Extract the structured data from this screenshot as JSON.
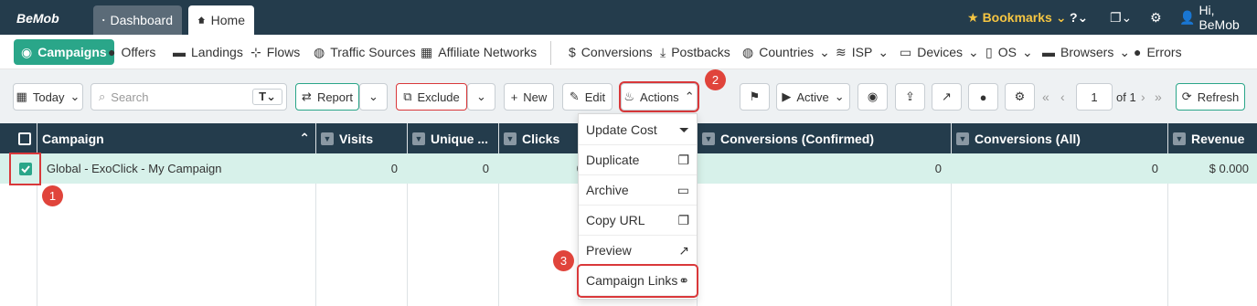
{
  "topbar": {
    "logo": "BeMob",
    "dashboard": "Dashboard",
    "home": "Home",
    "bookmarks": "Bookmarks",
    "user": "Hi, BeMob"
  },
  "nav": {
    "campaigns": "Campaigns",
    "offers": "Offers",
    "landings": "Landings",
    "flows": "Flows",
    "traffic": "Traffic Sources",
    "affiliate": "Affiliate Networks",
    "conversions": "Conversions",
    "postbacks": "Postbacks",
    "countries": "Countries",
    "isp": "ISP",
    "devices": "Devices",
    "os": "OS",
    "browsers": "Browsers",
    "errors": "Errors"
  },
  "toolbar": {
    "date": "Today",
    "search_placeholder": "Search",
    "report": "Report",
    "exclude": "Exclude",
    "new": "New",
    "edit": "Edit",
    "actions": "Actions",
    "active": "Active",
    "page": "1",
    "of": "of 1",
    "refresh": "Refresh"
  },
  "table": {
    "headers": [
      "Campaign",
      "Visits",
      "Unique ...",
      "Clicks",
      "Conversions (Confirmed)",
      "Conversions (All)",
      "Revenue"
    ],
    "row": {
      "name": "Global - ExoClick - My Campaign",
      "visits": "0",
      "unique": "0",
      "clicks": "0",
      "conv_confirmed": "0",
      "conv_all": "0",
      "revenue": "$ 0.000"
    }
  },
  "menu": [
    "Update Cost",
    "Duplicate",
    "Archive",
    "Copy URL",
    "Preview",
    "Campaign Links"
  ],
  "badges": [
    "1",
    "2",
    "3"
  ],
  "colors": {
    "navy": "#243c4c",
    "accent": "#2aa689",
    "highlight": "#d9383a"
  }
}
